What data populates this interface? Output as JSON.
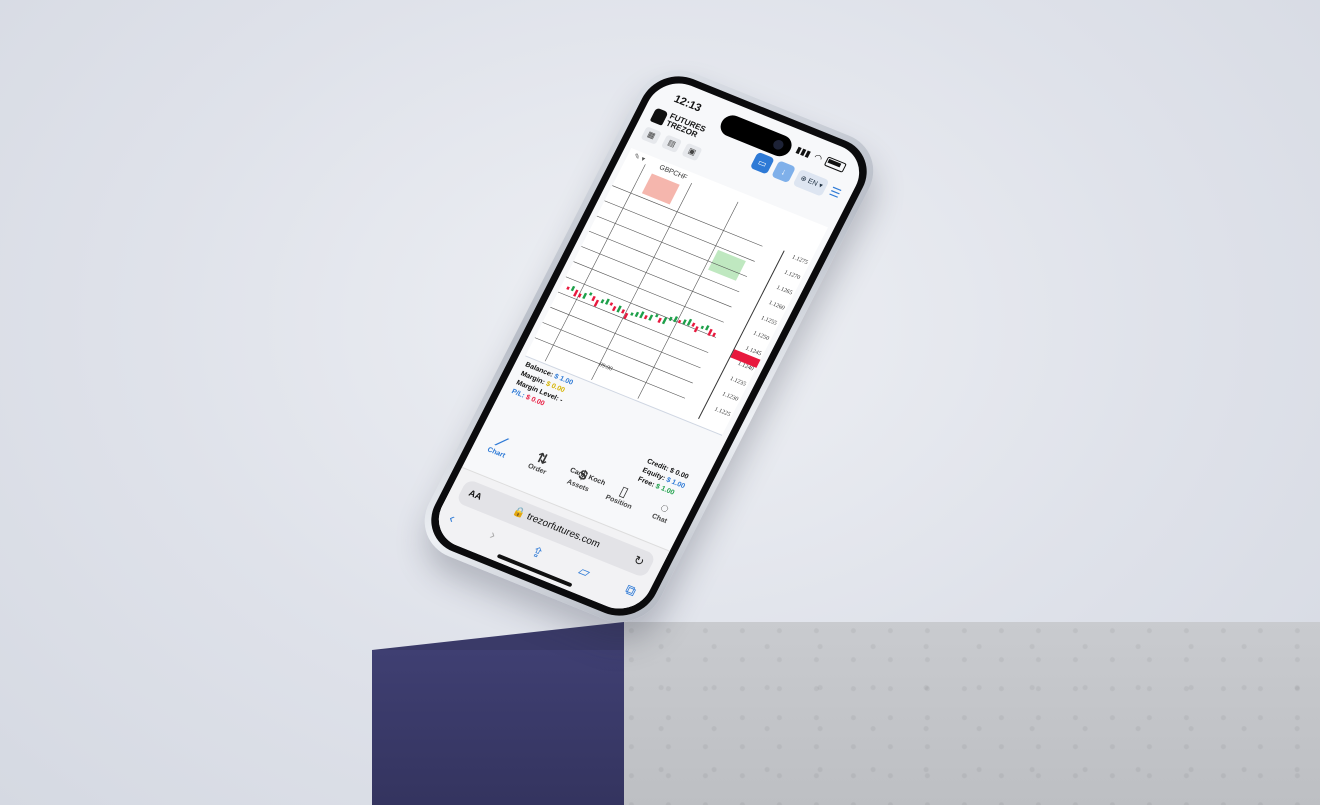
{
  "status": {
    "time": "12:13"
  },
  "header": {
    "logo_line1": "FUTURES",
    "logo_line2": "TREZOR",
    "language": "EN"
  },
  "chart": {
    "symbol": "GBPCHF",
    "price_labels": [
      "1.1275",
      "1.1270",
      "1.1265",
      "1.1260",
      "1.1255",
      "1.1250",
      "1.1245",
      "1.1240",
      "1.1235",
      "1.1230",
      "1.1225"
    ],
    "time_labels": [
      "09:00"
    ]
  },
  "account": {
    "balance_label": "Balance:",
    "balance_value": "$ 1.00",
    "margin_label": "Margin:",
    "margin_value": "$ 0.00",
    "margin_level_label": "Margin Level:",
    "margin_level_value": "-",
    "pl_label": "P/L:",
    "pl_value": "$ 0.00",
    "credit_label": "Credit:",
    "credit_value": "$ 0.00",
    "equity_label": "Equity:",
    "equity_value": "$ 1.00",
    "free_label": "Free:",
    "free_value": "$ 1.00"
  },
  "user": {
    "name": "Carol Koch"
  },
  "tabs": [
    {
      "label": "Chart",
      "icon": "chart-icon"
    },
    {
      "label": "Order",
      "icon": "order-icon"
    },
    {
      "label": "Assets",
      "icon": "dollar-icon"
    },
    {
      "label": "Position",
      "icon": "clipboard-icon"
    },
    {
      "label": "Chat",
      "icon": "chat-icon"
    }
  ],
  "browser": {
    "text_size": "AA",
    "url": "trezorfutures.com"
  },
  "colors": {
    "accent": "#2e7ad6",
    "sell": "#e8193e",
    "buy": "#1ea04a"
  }
}
